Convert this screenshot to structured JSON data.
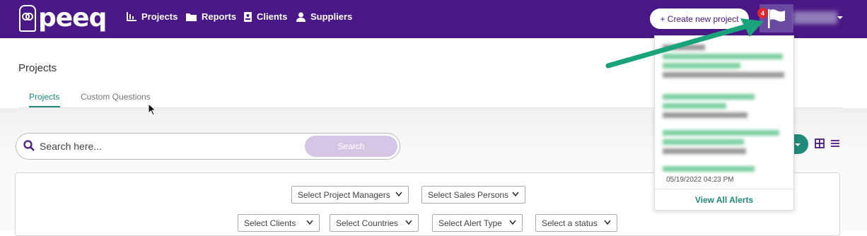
{
  "brand": {
    "name": "peeq"
  },
  "nav": [
    {
      "label": "Projects",
      "icon": "bar-chart-icon"
    },
    {
      "label": "Reports",
      "icon": "folder-icon"
    },
    {
      "label": "Clients",
      "icon": "id-card-icon"
    },
    {
      "label": "Suppliers",
      "icon": "user-icon"
    }
  ],
  "header": {
    "create_button": "+ Create new project",
    "alert_count": "4"
  },
  "page": {
    "title": "Projects",
    "tabs": [
      {
        "label": "Projects",
        "active": true
      },
      {
        "label": "Custom Questions",
        "active": false
      }
    ]
  },
  "search": {
    "placeholder": "Search here...",
    "button": "Search"
  },
  "filters": {
    "row1": [
      "Select Project Managers",
      "Select Sales Persons"
    ],
    "row2": [
      "Select Clients",
      "Select Countries",
      "Select Alert Type",
      "Select a status"
    ]
  },
  "alerts": {
    "footer": "View All Alerts",
    "partial_date": "05/19/2022 04:23 PM"
  },
  "colors": {
    "brand_purple": "#4a1886",
    "accent_teal": "#1f8a7a",
    "badge_red": "#e0262d",
    "arrow_green": "#1aa37a"
  }
}
